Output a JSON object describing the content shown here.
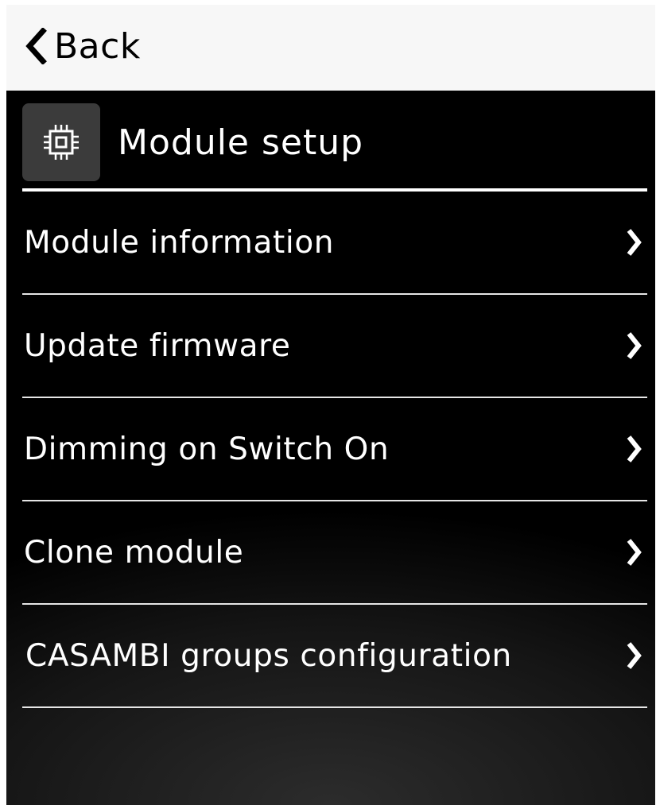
{
  "nav": {
    "back_label": "Back",
    "back_icon": "chevron-left-icon"
  },
  "header": {
    "title": "Module setup",
    "icon": "chip-icon"
  },
  "menu": {
    "items": [
      {
        "label": "Module information",
        "icon": "chevron-right-icon"
      },
      {
        "label": "Update firmware",
        "icon": "chevron-right-icon"
      },
      {
        "label": "Dimming on Switch On",
        "icon": "chevron-right-icon"
      },
      {
        "label": "Clone module",
        "icon": "chevron-right-icon"
      },
      {
        "label": "CASAMBI groups configuration",
        "icon": "chevron-right-icon"
      }
    ]
  },
  "colors": {
    "background": "#000000",
    "topbar": "#f7f7f7",
    "text": "#ffffff",
    "divider": "#e6e6e6",
    "icon_box": "#3b3b3b"
  }
}
